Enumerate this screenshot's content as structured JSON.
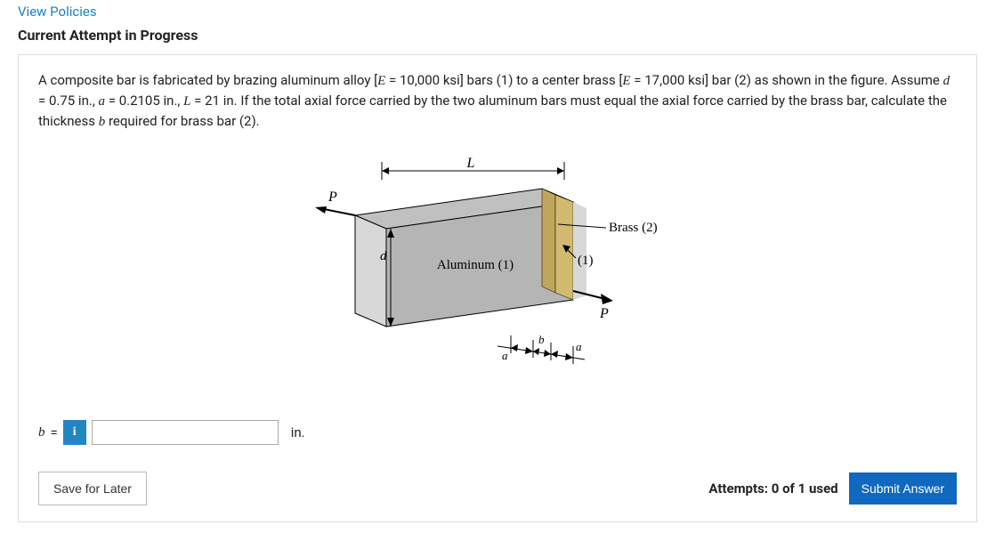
{
  "links": {
    "view_policies": "View Policies"
  },
  "header": {
    "attempt": "Current Attempt in Progress"
  },
  "problem": {
    "seg1": "A composite bar is fabricated by brazing aluminum alloy [",
    "E": "E",
    "seg2": " = ",
    "val1": "10,000 ksi",
    "seg3": "] bars (1) to a center brass [",
    "seg4": " = ",
    "val2": "17,000 ksi",
    "seg5": "] bar (2) as shown in the figure. Assume ",
    "d": "d",
    "seg6": " = ",
    "val3": "0.75 in.",
    "seg7": ", ",
    "a": "a",
    "seg8": " = ",
    "val4": "0.2105 in.",
    "seg9": ", ",
    "Lvar": "L",
    "seg10": " = ",
    "val5": "21 in.",
    "seg11": " If the total axial force carried by the two aluminum bars must equal the axial force carried by the brass bar, calculate the thickness ",
    "b": "b",
    "seg12": " required for brass bar (2)."
  },
  "diagram": {
    "L": "L",
    "P1": "P",
    "P2": "P",
    "d": "d",
    "alu": "Aluminum (1)",
    "one": "(1)",
    "brass": "Brass (2)",
    "a1": "a",
    "b": "b",
    "a2": "a"
  },
  "answer": {
    "var": "b",
    "eq": " = ",
    "info": "i",
    "unit": "in."
  },
  "footer": {
    "save": "Save for Later",
    "attempts": "Attempts: 0 of 1 used",
    "submit": "Submit Answer"
  }
}
